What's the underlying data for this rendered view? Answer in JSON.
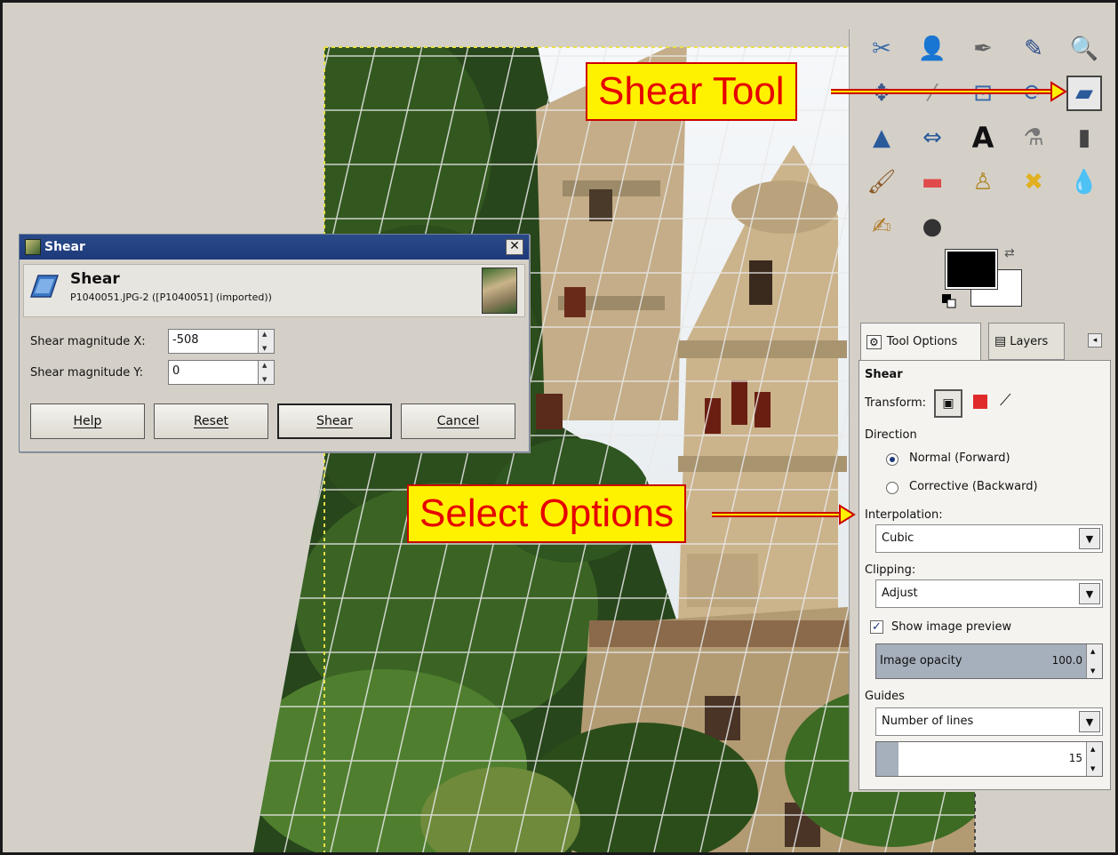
{
  "dialog": {
    "window_title": "Shear",
    "header_title": "Shear",
    "header_subtitle": "P1040051.JPG-2 ([P1040051] (imported))",
    "close_glyph": "✕",
    "label_x": "Shear magnitude X:",
    "value_x": "-508",
    "label_y": "Shear magnitude Y:",
    "value_y": "0",
    "buttons": {
      "help": "Help",
      "reset": "Reset",
      "shear": "Shear",
      "cancel": "Cancel"
    }
  },
  "tool_options": {
    "tab_tool_options": "Tool Options",
    "tab_layers": "Layers",
    "section_title": "Shear",
    "transform_label": "Transform:",
    "direction_label": "Direction",
    "direction_normal": "Normal (Forward)",
    "direction_corrective": "Corrective (Backward)",
    "direction_selected": "Normal (Forward)",
    "interpolation_label": "Interpolation:",
    "interpolation_value": "Cubic",
    "clipping_label": "Clipping:",
    "clipping_value": "Adjust",
    "show_preview_label": "Show image preview",
    "show_preview_checked": true,
    "opacity_label": "Image opacity",
    "opacity_value": "100.0",
    "opacity_fraction": 1.0,
    "guides_label": "Guides",
    "guides_value": "Number of lines",
    "lines_value": "15",
    "lines_fraction": 0.1
  },
  "toolbox": {
    "tools": [
      {
        "name": "scissors-select-icon",
        "glyph": "✂",
        "color": "#3a6aa8"
      },
      {
        "name": "foreground-select-icon",
        "glyph": "👤",
        "color": "#3a5a9a"
      },
      {
        "name": "paths-icon",
        "glyph": "✒",
        "color": "#666666"
      },
      {
        "name": "color-picker-icon",
        "glyph": "✎",
        "color": "#2a4a8a"
      },
      {
        "name": "zoom-icon",
        "glyph": "🔍",
        "color": "#3a6aa8"
      },
      {
        "name": "move-icon",
        "glyph": "✥",
        "color": "#3a5a8a"
      },
      {
        "name": "align-icon",
        "glyph": "⁄",
        "color": "#888888"
      },
      {
        "name": "crop-icon",
        "glyph": "⊡",
        "color": "#3a6aa8"
      },
      {
        "name": "rotate-icon",
        "glyph": "⟳",
        "color": "#3a6aa8"
      },
      {
        "name": "shear-tool-icon",
        "glyph": "▰",
        "color": "#2a5a9a",
        "selected": true
      },
      {
        "name": "perspective-icon",
        "glyph": "▲",
        "color": "#2a5a9a"
      },
      {
        "name": "flip-icon",
        "glyph": "⇔",
        "color": "#2a5a9a"
      },
      {
        "name": "text-tool-icon",
        "glyph": "A",
        "color": "#111111"
      },
      {
        "name": "bucket-fill-icon",
        "glyph": "⚗",
        "color": "#777777"
      },
      {
        "name": "blend-icon",
        "glyph": "▮",
        "color": "#444444"
      },
      {
        "name": "paintbrush-icon",
        "glyph": "🖌",
        "color": "#8a5a2a"
      },
      {
        "name": "eraser-icon",
        "glyph": "▬",
        "color": "#e04a4a"
      },
      {
        "name": "clone-icon",
        "glyph": "♙",
        "color": "#b08a2a"
      },
      {
        "name": "heal-icon",
        "glyph": "✖",
        "color": "#e0b020"
      },
      {
        "name": "blur-icon",
        "glyph": "💧",
        "color": "#3a7ab8"
      },
      {
        "name": "smudge-icon",
        "glyph": "✍",
        "color": "#b07a2a"
      },
      {
        "name": "dodge-burn-icon",
        "glyph": "●",
        "color": "#333333"
      }
    ],
    "fg_color": "#000000",
    "bg_color": "#ffffff"
  },
  "callouts": {
    "shear_tool": "Shear Tool",
    "select_options": "Select Options"
  },
  "colors": {
    "callout_bg": "#fff200",
    "callout_text": "#e60000",
    "dialog_bg": "#d4d0c8",
    "title_bar": "#1d3a7a"
  }
}
